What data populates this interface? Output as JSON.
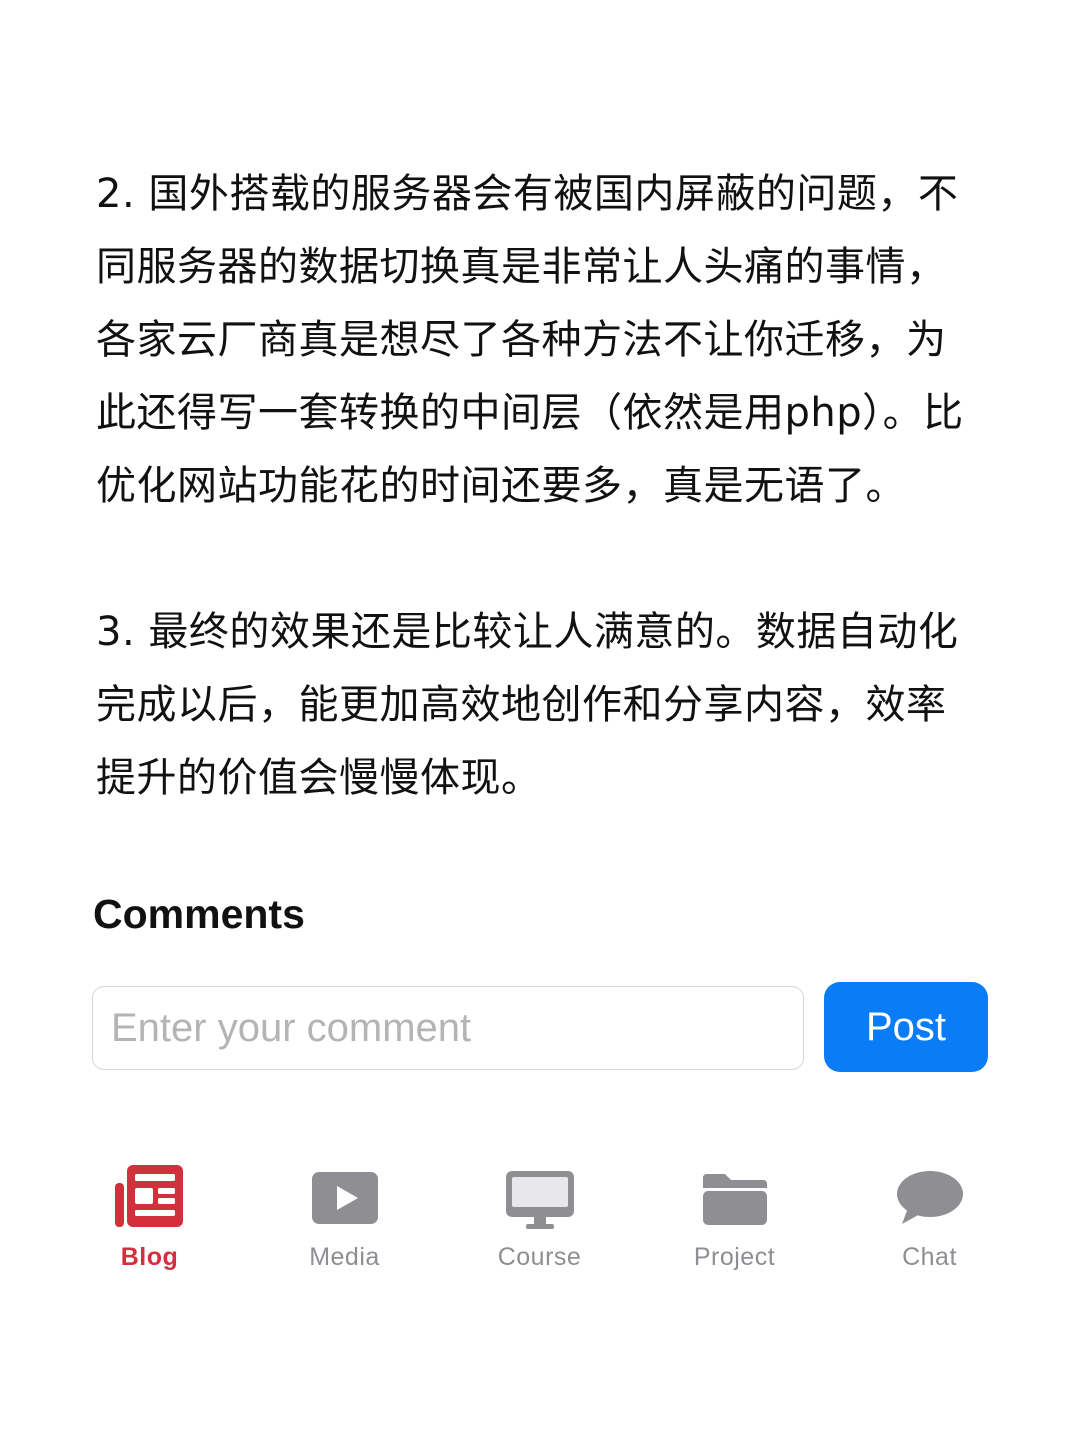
{
  "article": {
    "paragraphs": [
      "2. 国外搭载的服务器会有被国内屏蔽的问题，不同服务器的数据切换真是非常让人头痛的事情，各家云厂商真是想尽了各种方法不让你迁移，为此还得写一套转换的中间层（依然是用php）。比优化网站功能花的时间还要多，真是无语了。",
      "3. 最终的效果还是比较让人满意的。数据自动化完成以后，能更加高效地创作和分享内容，效率提升的价值会慢慢体现。"
    ]
  },
  "comments": {
    "title": "Comments",
    "input_placeholder": "Enter your comment",
    "input_value": "",
    "post_label": "Post"
  },
  "tabbar": {
    "active_color": "#d1313c",
    "inactive_color": "#8e8e93",
    "accent_color": "#0a7cf5",
    "items": [
      {
        "label": "Blog",
        "icon": "newspaper-icon",
        "active": true
      },
      {
        "label": "Media",
        "icon": "play-icon",
        "active": false
      },
      {
        "label": "Course",
        "icon": "monitor-icon",
        "active": false
      },
      {
        "label": "Project",
        "icon": "folder-icon",
        "active": false
      },
      {
        "label": "Chat",
        "icon": "chat-bubble-icon",
        "active": false
      }
    ]
  }
}
